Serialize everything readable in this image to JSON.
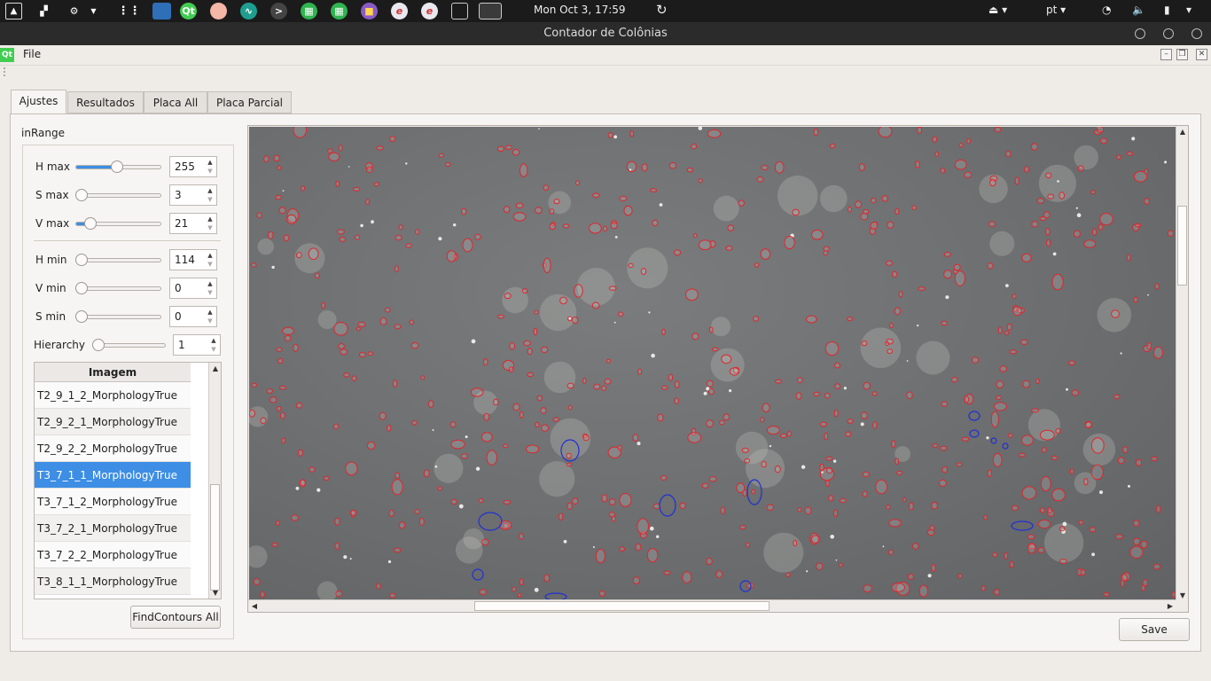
{
  "system_bar": {
    "clock": "Mon Oct  3, 17:59",
    "language": "pt",
    "apps": [
      "image-viewer-icon",
      "workspace-icon",
      "gear-icon",
      "menu-icon",
      "apps-grid-icon",
      "monitor-icon",
      "qt-creator-icon",
      "pink-app-icon",
      "activity-icon",
      "terminal-icon",
      "spreadsheet-icon",
      "spreadsheet2-icon",
      "files-icon",
      "editor-icon",
      "editor2-icon",
      "window1-icon",
      "window2-icon"
    ]
  },
  "window": {
    "title": "Contador de Colônias"
  },
  "menu": {
    "file": "File",
    "logo": "Qt"
  },
  "tabs": [
    {
      "label": "Ajustes",
      "active": true
    },
    {
      "label": "Resultados",
      "active": false
    },
    {
      "label": "Placa All",
      "active": false
    },
    {
      "label": "Placa Parcial",
      "active": false
    }
  ],
  "panel": {
    "group_label": "inRange",
    "controls": [
      {
        "label": "H max",
        "value": "255",
        "slider_fraction": 0.48
      },
      {
        "label": "S max",
        "value": "3",
        "slider_fraction": 0.0
      },
      {
        "label": "V max",
        "value": "21",
        "slider_fraction": 0.12
      },
      {
        "label": "H min",
        "value": "114",
        "slider_fraction": 0.0
      },
      {
        "label": "V min",
        "value": "0",
        "slider_fraction": 0.0
      },
      {
        "label": "S min",
        "value": "0",
        "slider_fraction": 0.0
      },
      {
        "label": "Hierarchy",
        "value": "1",
        "slider_fraction": 0.0
      }
    ],
    "list_header": "Imagem",
    "list_items": [
      {
        "label": "T2_9_1_2_MorphologyTrue",
        "selected": false
      },
      {
        "label": "T2_9_2_1_MorphologyTrue",
        "selected": false
      },
      {
        "label": "T2_9_2_2_MorphologyTrue",
        "selected": false
      },
      {
        "label": "T3_7_1_1_MorphologyTrue",
        "selected": true
      },
      {
        "label": "T3_7_1_2_MorphologyTrue",
        "selected": false
      },
      {
        "label": "T3_7_2_1_MorphologyTrue",
        "selected": false
      },
      {
        "label": "T3_7_2_2_MorphologyTrue",
        "selected": false
      },
      {
        "label": "T3_8_1_1_MorphologyTrue",
        "selected": false
      }
    ],
    "find_contours_button": "FindContours All"
  },
  "save_button": "Save",
  "colors": {
    "accent": "#3d8ee4",
    "contour_red": "#e0262b",
    "contour_blue": "#1f2fd6",
    "plate": "#6e7072"
  }
}
